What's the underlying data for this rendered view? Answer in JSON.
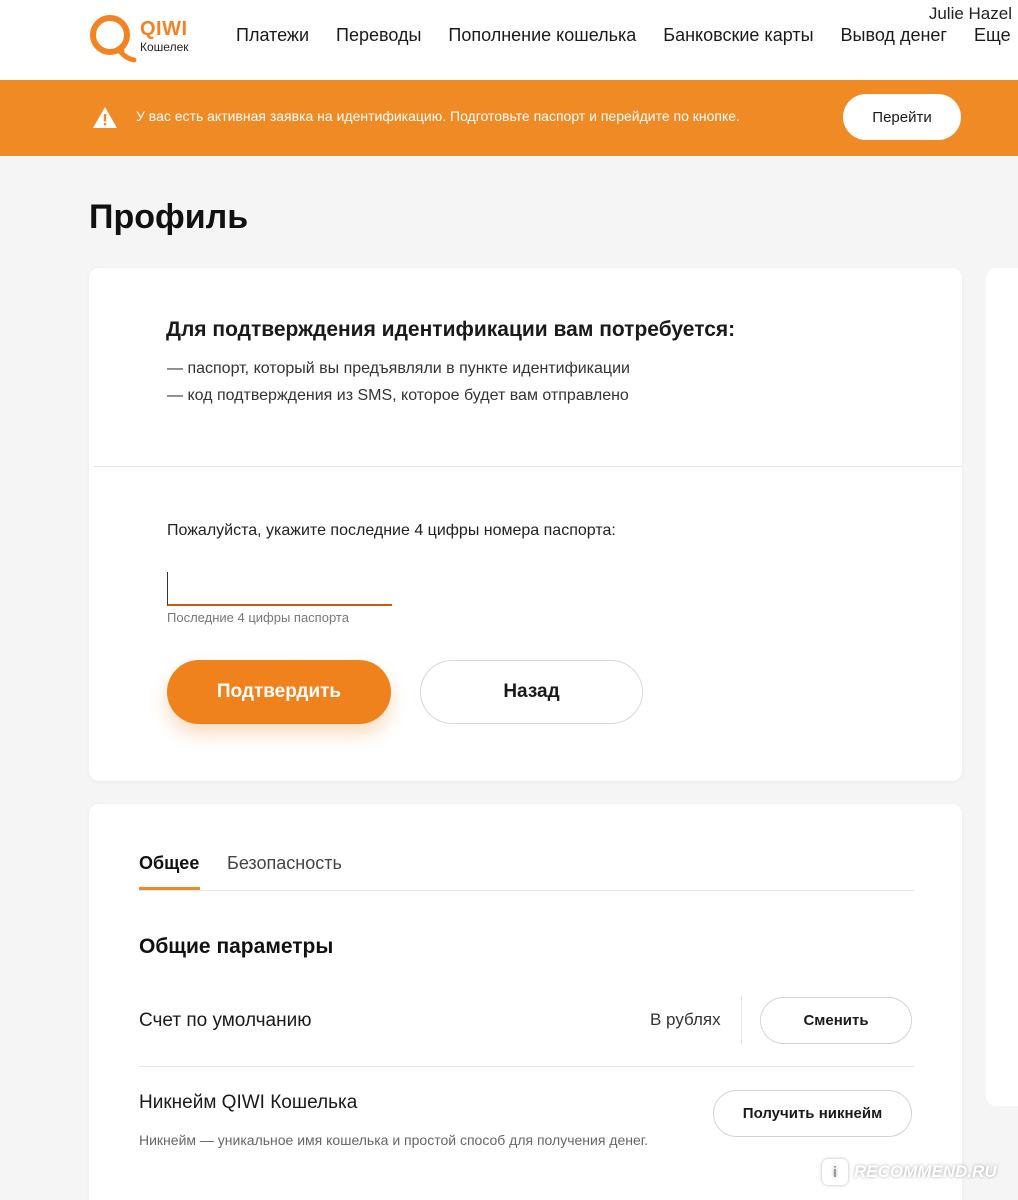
{
  "header": {
    "logo_name": "QIWI",
    "logo_sub": "Кошелек",
    "nav": [
      "Платежи",
      "Переводы",
      "Пополнение кошелька",
      "Банковские карты",
      "Вывод денег",
      "Еще"
    ],
    "user_name": "Julie Hazel"
  },
  "banner": {
    "icon": "warning-triangle-icon",
    "text": "У вас есть активная заявка на идентификацию. Подготовьте паспорт и перейдите по кнопке.",
    "button_label": "Перейти",
    "color": "#f08a24"
  },
  "page_title": "Профиль",
  "verification": {
    "title": "Для подтверждения идентификации вам потребуется:",
    "requirements": [
      "— паспорт, который вы предъявляли в пункте идентификации",
      "— код подтверждения из SMS, которое будет вам отправлено"
    ],
    "prompt": "Пожалуйста, укажите последние 4 цифры номера паспорта:",
    "input_value": "",
    "input_help": "Последние 4 цифры паспорта",
    "confirm_label": "Подтвердить",
    "back_label": "Назад"
  },
  "settings": {
    "tabs": [
      "Общее",
      "Безопасность"
    ],
    "active_tab": "Общее",
    "section_title": "Общие параметры",
    "default_account": {
      "label": "Счет по умолчанию",
      "value": "В рублях",
      "button_label": "Сменить"
    },
    "nickname": {
      "label": "Никнейм QIWI Кошелька",
      "description": "Никнейм — уникальное имя кошелька и простой способ для получения денег.",
      "button_label": "Получить никнейм"
    }
  },
  "watermark": {
    "badge": "i",
    "text": "RECOMMEND.RU"
  },
  "colors": {
    "accent": "#f08a24",
    "brand": "#f58220",
    "background": "#f5f5f5"
  }
}
